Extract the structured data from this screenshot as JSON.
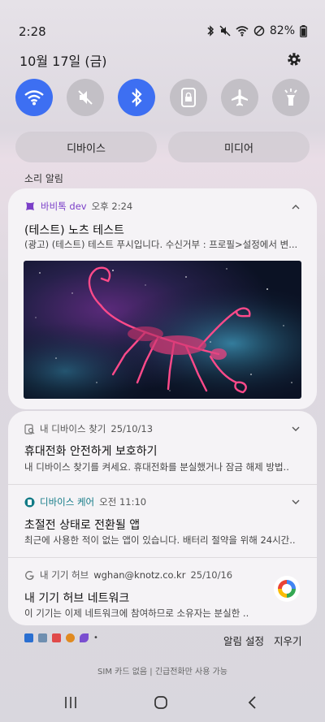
{
  "status": {
    "time": "2:28",
    "battery": "82%"
  },
  "date": "10월 17일 (금)",
  "quick_settings": {
    "tiles": [
      {
        "name": "wifi",
        "state": "on"
      },
      {
        "name": "sound-mute",
        "state": "off"
      },
      {
        "name": "bluetooth",
        "state": "on"
      },
      {
        "name": "lock-screen",
        "state": "off"
      },
      {
        "name": "airplane",
        "state": "off"
      },
      {
        "name": "flashlight",
        "state": "off"
      }
    ],
    "devices_label": "디바이스",
    "media_label": "미디어"
  },
  "section_label": "소리 알림",
  "notifications": [
    {
      "app": "바비톡 dev",
      "time": "오후 2:24",
      "title": "(테스트) 노츠 테스트",
      "body": "(광고) (테스트) 테스트 푸시입니다.  수신거부 : 프로필>설정에서 변..."
    },
    {
      "app": "내 디바이스 찾기",
      "time": "25/10/13",
      "title": "휴대전화 안전하게 보호하기",
      "body": "내 디바이스 찾기를 켜세요. 휴대전화를 분실했거나 잠금 해제 방법.."
    },
    {
      "app": "디바이스 케어",
      "time": "오전 11:10",
      "title": "초절전 상태로 전환될 앱",
      "body": "최근에 사용한 적이 없는 앱이 있습니다. 배터리 절약을 위해 24시간.."
    },
    {
      "app": "내 기기 허브",
      "account": "wghan@knotz.co.kr",
      "time": "25/10/16",
      "title": "내 기기 허브 네트워크",
      "body": "이 기기는 이제 네트워크에 참여하므로 소유자는 분실한 .."
    }
  ],
  "actions": {
    "settings": "알림 설정",
    "clear": "지우기"
  },
  "sim_status": "SIM 카드 없음 | 긴급전화만 사용 가능",
  "colors": {
    "accent": "#3d6ff2",
    "tile_off": "#c3c0c6",
    "card_bg": "#f5f3f6"
  }
}
